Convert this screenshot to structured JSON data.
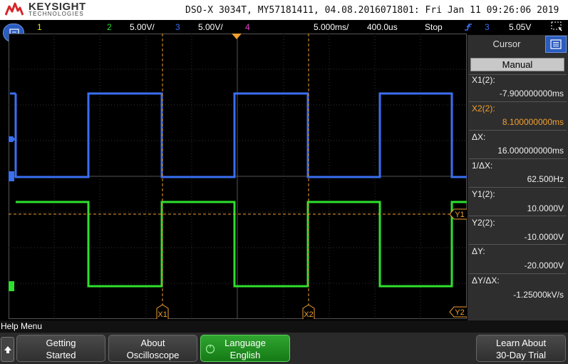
{
  "header": {
    "brand": "KEYSIGHT",
    "brand_sub": "TECHNOLOGIES",
    "instrument": "DSO-X 3034T, MY57181411, 04.08.2016071801: Fri Jan 11 09:26:06 2019"
  },
  "status_bar": {
    "ch1_num": "1",
    "ch2_num": "2",
    "ch2_scale": "5.00V/",
    "ch3_num": "3",
    "ch3_scale": "5.00V/",
    "ch4_num": "4",
    "timebase": "5.000ms/",
    "delay": "400.0us",
    "run_state": "Stop",
    "trigger_source": "3",
    "trigger_level": "5.05V"
  },
  "plot": {
    "cursor_labels": {
      "x1": "X1",
      "x2": "X2",
      "y1": "Y1",
      "y2": "Y2"
    },
    "trigger_marker": "T",
    "colors": {
      "ch2": "#2ee02e",
      "ch3": "#3a6ff0",
      "cursor": "#f0a030",
      "grid": "#3a3a3a",
      "ch1": "#e8e800",
      "ch4": "#e040c8"
    }
  },
  "cursor_panel": {
    "title": "Cursor",
    "mode": "Manual",
    "x1_label": "X1(2):",
    "x1_value": "-7.900000000ms",
    "x2_label": "X2(2):",
    "x2_value": "8.100000000ms",
    "dx_label": "ΔX:",
    "dx_value": "16.000000000ms",
    "inv_dx_label": "1/ΔX:",
    "inv_dx_value": "62.500Hz",
    "y1_label": "Y1(2):",
    "y1_value": "10.0000V",
    "y2_label": "Y2(2):",
    "y2_value": "-10.0000V",
    "dy_label": "ΔY:",
    "dy_value": "-20.0000V",
    "dydx_label": "ΔY/ΔX:",
    "dydx_value": "-1.25000kV/s"
  },
  "help_menu": {
    "title": "Help Menu"
  },
  "softkeys": [
    {
      "line1": "Getting",
      "line2": "Started"
    },
    {
      "line1": "About",
      "line2": "Oscilloscope"
    },
    {
      "line1": "Language",
      "line2": "English"
    },
    {
      "line1": "Learn About",
      "line2": "30-Day Trial"
    }
  ]
}
